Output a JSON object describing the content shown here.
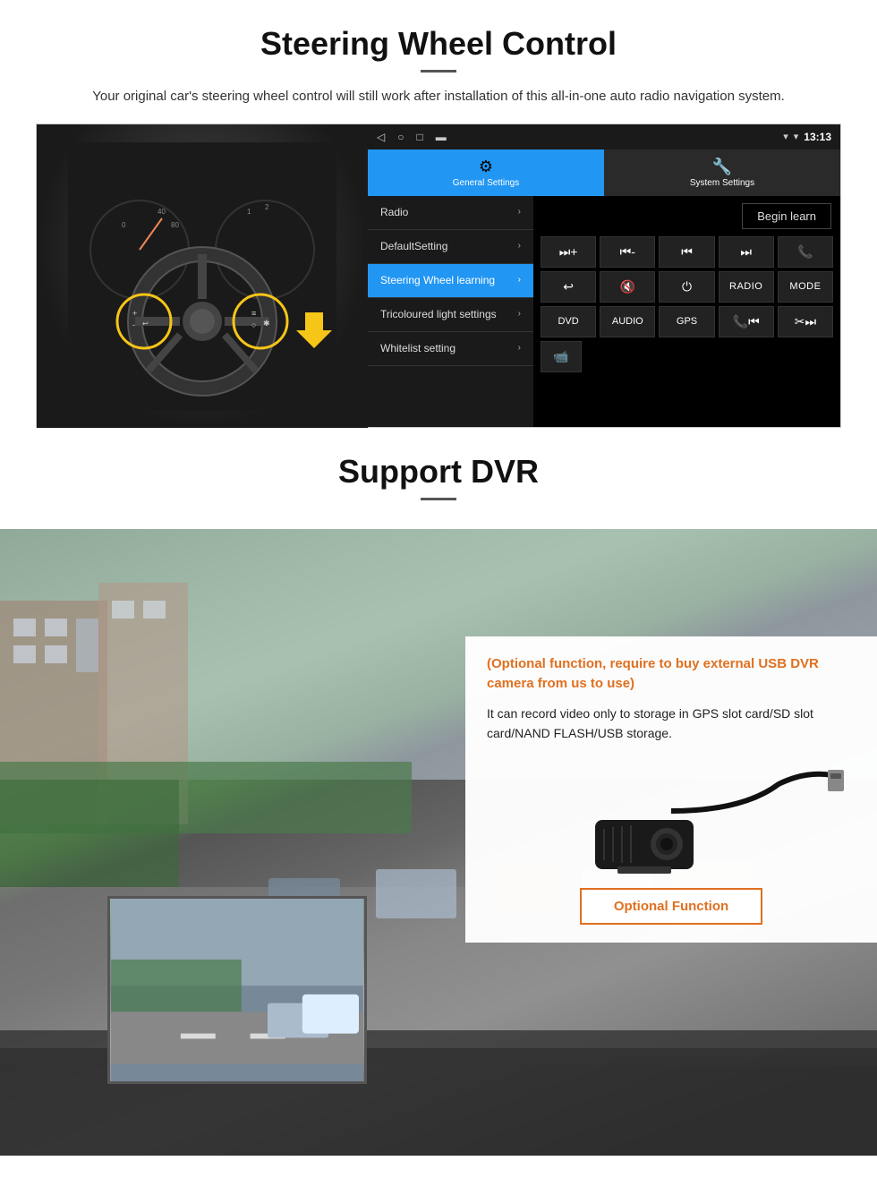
{
  "steering_section": {
    "title": "Steering Wheel Control",
    "description": "Your original car's steering wheel control will still work after installation of this all-in-one auto radio navigation system.",
    "status_bar": {
      "nav_icons": [
        "◁",
        "○",
        "□",
        "▬"
      ],
      "signal_icons": [
        "▾",
        "▾"
      ],
      "time": "13:13"
    },
    "tabs": [
      {
        "icon": "⚙",
        "label": "General Settings",
        "active": true
      },
      {
        "icon": "🔧",
        "label": "System Settings",
        "active": false
      }
    ],
    "menu_items": [
      {
        "label": "Radio",
        "active": false
      },
      {
        "label": "DefaultSetting",
        "active": false
      },
      {
        "label": "Steering Wheel learning",
        "active": true
      },
      {
        "label": "Tricoloured light settings",
        "active": false
      },
      {
        "label": "Whitelist setting",
        "active": false
      }
    ],
    "begin_learn_label": "Begin learn",
    "control_buttons": {
      "row1": [
        "⏭+",
        "⏮-",
        "⏮⏮",
        "⏭⏭",
        "📞"
      ],
      "row2": [
        "↩",
        "🔇",
        "⏻",
        "RADIO",
        "MODE"
      ],
      "row3": [
        "DVD",
        "AUDIO",
        "GPS",
        "📞⏮",
        "✂⏭"
      ],
      "row4": [
        "📹"
      ]
    }
  },
  "dvr_section": {
    "title": "Support DVR",
    "optional_text": "(Optional function, require to buy external USB DVR camera from us to use)",
    "description": "It can record video only to storage in GPS slot card/SD slot card/NAND FLASH/USB storage.",
    "optional_button_label": "Optional Function"
  }
}
